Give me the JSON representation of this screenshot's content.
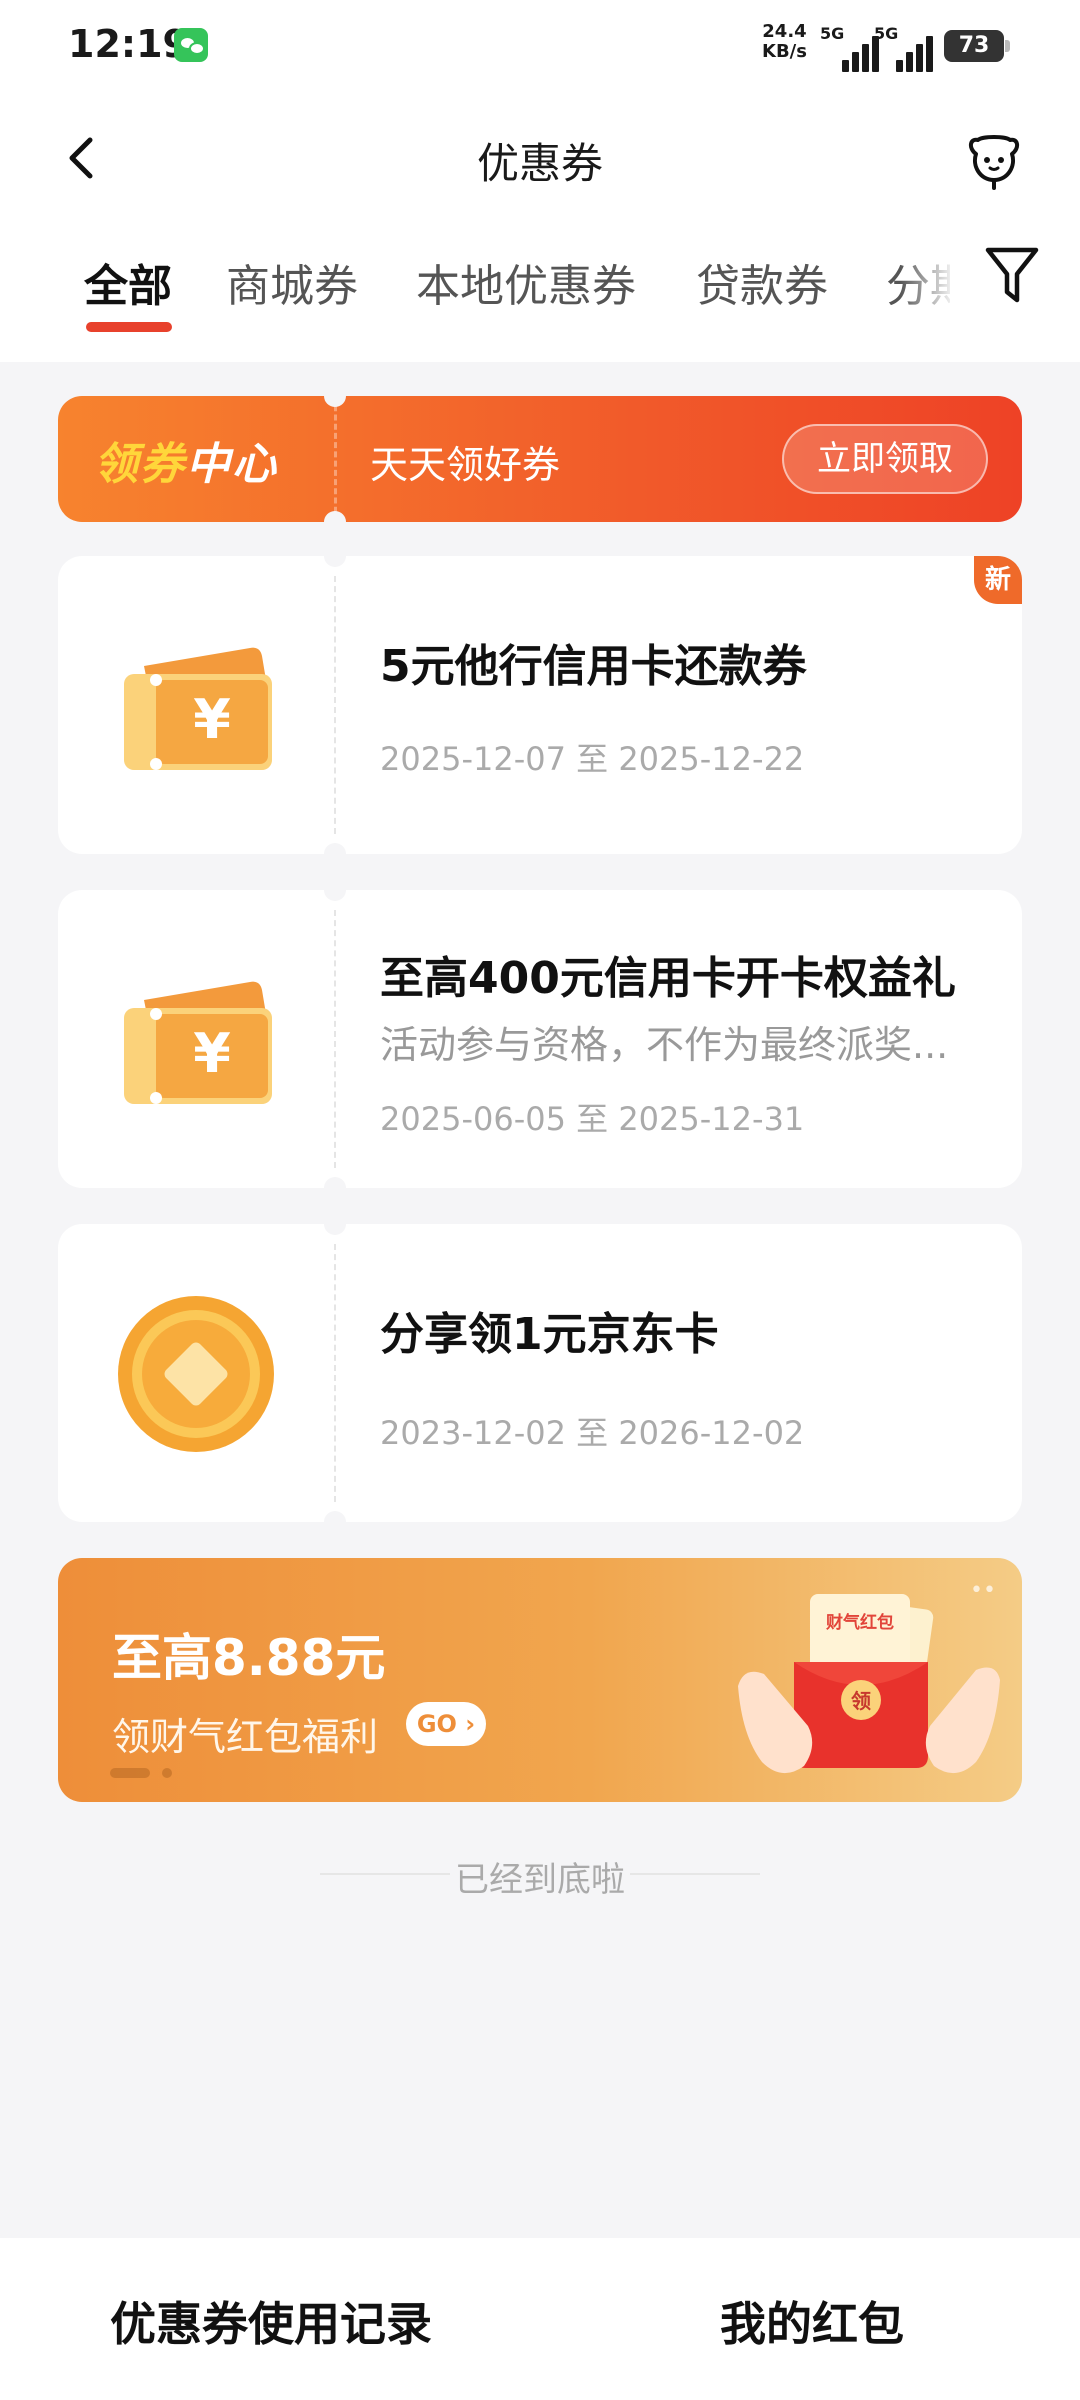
{
  "status": {
    "time": "12:19",
    "net_speed_value": "24.4",
    "net_speed_unit": "KB/s",
    "sim1_label": "5G",
    "sim2_label": "5G",
    "battery": "73"
  },
  "header": {
    "title": "优惠券"
  },
  "tabs": [
    {
      "label": "全部",
      "active": true
    },
    {
      "label": "商城券"
    },
    {
      "label": "本地优惠券"
    },
    {
      "label": "贷款券"
    },
    {
      "label": "分期券"
    }
  ],
  "banner": {
    "logo_part1": "领券",
    "logo_part2": "中心",
    "text": "天天领好券",
    "button": "立即领取"
  },
  "coupons": [
    {
      "title": "5元他行信用卡还款券",
      "date": "2025-12-07 至 2025-12-22",
      "badge": "新",
      "icon": "ticket-icon"
    },
    {
      "title": "至高400元信用卡开卡权益礼",
      "desc": "活动参与资格，不作为最终派奖...",
      "date": "2025-06-05 至 2025-12-31",
      "icon": "ticket-icon"
    },
    {
      "title": "分享领1元京东卡",
      "date": "2023-12-02 至 2026-12-02",
      "icon": "coin-icon"
    }
  ],
  "promo": {
    "title": "至高8.88元",
    "subtitle": "领财气红包福利",
    "go": "GO",
    "envelope_label": "财气红包",
    "seal": "领"
  },
  "end_text": "已经到底啦",
  "bottom": {
    "left": "优惠券使用记录",
    "right": "我的红包"
  },
  "colors": {
    "accent": "#e8412c",
    "banner_start": "#f7832e",
    "banner_end": "#ee4226",
    "ticket": "#f5a742",
    "promo_start": "#ee8e39",
    "promo_end": "#f4cc86"
  }
}
